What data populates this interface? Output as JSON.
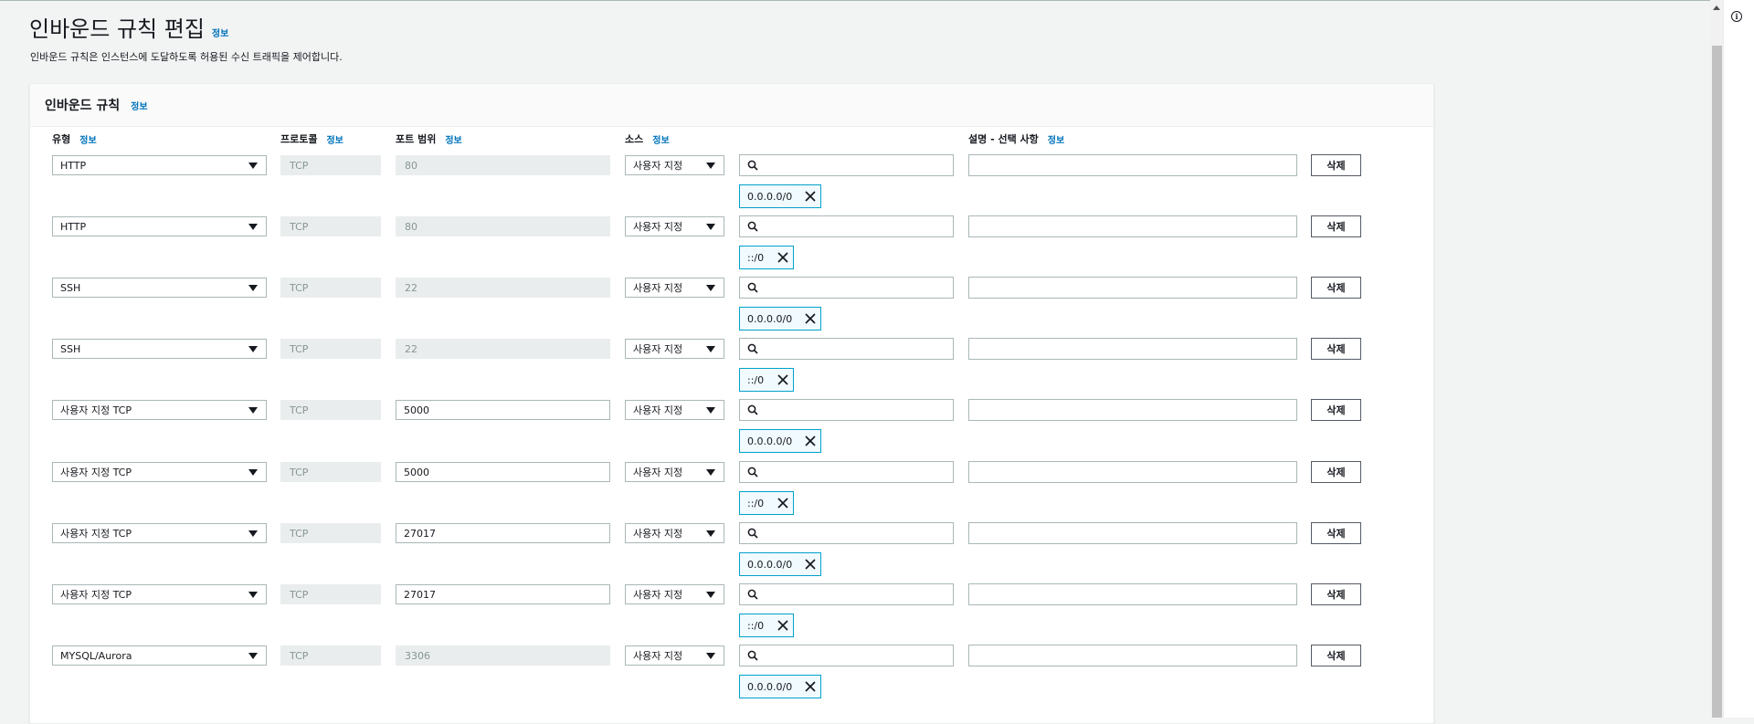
{
  "header": {
    "title": "인바운드 규칙 편집",
    "info": "정보",
    "description": "인바운드 규칙은 인스턴스에 도달하도록 허용된 수신 트래픽을 제어합니다."
  },
  "panel": {
    "title": "인바운드 규칙",
    "info": "정보",
    "columns": {
      "type": "유형",
      "protocol": "프로토콜",
      "port_range": "포트 범위",
      "source": "소스",
      "description": "설명 - 선택 사항",
      "info": "정보"
    }
  },
  "rules": [
    {
      "type": "HTTP",
      "protocol": "TCP",
      "port": "80",
      "port_editable": false,
      "source_type": "사용자 지정",
      "cidr": "0.0.0.0/0",
      "delete": "삭제"
    },
    {
      "type": "HTTP",
      "protocol": "TCP",
      "port": "80",
      "port_editable": false,
      "source_type": "사용자 지정",
      "cidr": "::/0",
      "delete": "삭제"
    },
    {
      "type": "SSH",
      "protocol": "TCP",
      "port": "22",
      "port_editable": false,
      "source_type": "사용자 지정",
      "cidr": "0.0.0.0/0",
      "delete": "삭제"
    },
    {
      "type": "SSH",
      "protocol": "TCP",
      "port": "22",
      "port_editable": false,
      "source_type": "사용자 지정",
      "cidr": "::/0",
      "delete": "삭제"
    },
    {
      "type": "사용자 지정 TCP",
      "protocol": "TCP",
      "port": "5000",
      "port_editable": true,
      "source_type": "사용자 지정",
      "cidr": "0.0.0.0/0",
      "delete": "삭제"
    },
    {
      "type": "사용자 지정 TCP",
      "protocol": "TCP",
      "port": "5000",
      "port_editable": true,
      "source_type": "사용자 지정",
      "cidr": "::/0",
      "delete": "삭제"
    },
    {
      "type": "사용자 지정 TCP",
      "protocol": "TCP",
      "port": "27017",
      "port_editable": true,
      "source_type": "사용자 지정",
      "cidr": "0.0.0.0/0",
      "delete": "삭제"
    },
    {
      "type": "사용자 지정 TCP",
      "protocol": "TCP",
      "port": "27017",
      "port_editable": true,
      "source_type": "사용자 지정",
      "cidr": "::/0",
      "delete": "삭제"
    },
    {
      "type": "MYSQL/Aurora",
      "protocol": "TCP",
      "port": "3306",
      "port_editable": false,
      "source_type": "사용자 지정",
      "cidr": "0.0.0.0/0",
      "delete": "삭제"
    }
  ],
  "colors": {
    "link": "#0073bb",
    "token_border": "#00a1c9",
    "token_bg": "#f1faff",
    "disabled_bg": "#eaeded"
  },
  "icons": {
    "search": "search-icon",
    "dismiss": "close-icon",
    "dropdown": "caret-down-icon",
    "info": "info-icon"
  }
}
